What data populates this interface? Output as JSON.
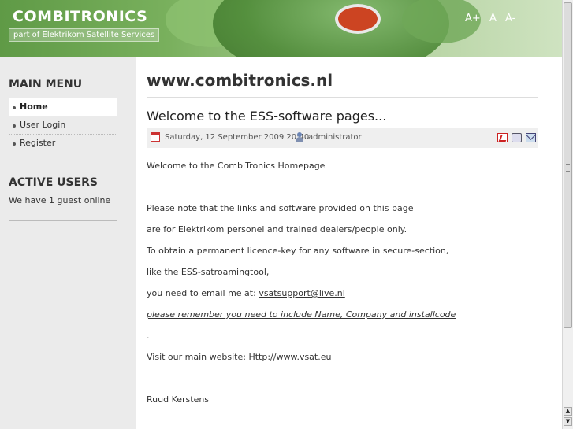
{
  "header": {
    "site_title": "COMBITRONICS",
    "site_subtitle": "part of Elektrikom Satellite Services",
    "font_sizer": {
      "increase": "A+",
      "reset": "A",
      "decrease": "A-"
    }
  },
  "sidebar": {
    "main_menu_title": "MAIN MENU",
    "menu_items": [
      {
        "label": "Home"
      },
      {
        "label": "User Login"
      },
      {
        "label": "Register"
      }
    ],
    "active_users_title": "ACTIVE USERS",
    "active_users_text": "We have 1 guest online"
  },
  "main": {
    "page_title": "www.combitronics.nl",
    "article": {
      "title": "Welcome to the ESS-software pages...",
      "date": "Saturday, 12 September 2009 20:40",
      "author": "administrator",
      "icons": {
        "pdf": "pdf-icon",
        "print": "print-icon",
        "email": "email-icon"
      },
      "lines": {
        "l1": "Welcome to the CombiTronics Homepage",
        "l2": "Please note that the links and software provided on this page",
        "l3": "are for Elektrikom personel and trained dealers/people only.",
        "l4": "To obtain a permanent licence-key for any software in secure-section,",
        "l5": "like the ESS-satroamingtool,",
        "l6_prefix": "you need to email me at: ",
        "l6_link": "vsatsupport@live.nl",
        "l7": "please remember you need to include Name, Company and installcode",
        "l8": ".",
        "l9_prefix": "Visit our main website: ",
        "l9_link": "Http://www.vsat.eu",
        "l10": "Ruud Kerstens"
      }
    }
  },
  "colors": {
    "header_green": "#79b05d",
    "sidebar_bg": "#ebebeb",
    "meta_bg": "#efefef"
  }
}
